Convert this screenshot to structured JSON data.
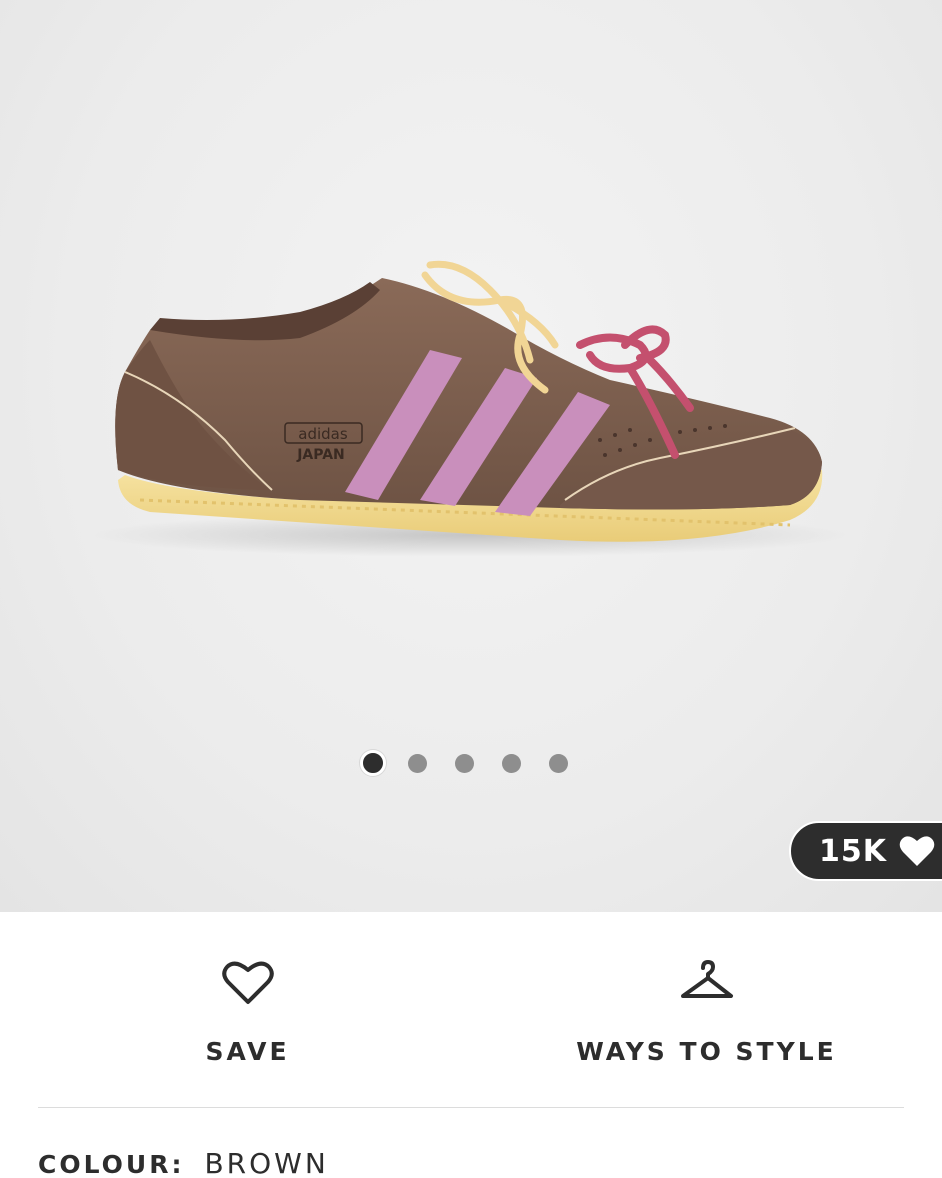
{
  "gallery": {
    "image_alt": "adidas JAPAN brown suede sneaker",
    "shoe_logo_text": "adidas",
    "shoe_logo_subtext": "JAPAN",
    "slide_count": 5,
    "active_slide": 1,
    "colors": {
      "suede": "#7d5f4e",
      "suede_dark": "#6b4f41",
      "stripes": "#c98fbc",
      "sole": "#f3dd94",
      "laces_main": "#f1d595",
      "laces_pink": "#c4506e"
    }
  },
  "likes": {
    "count": "15K",
    "icon": "heart-icon"
  },
  "actions": {
    "save_label": "SAVE",
    "save_icon": "heart-outline-icon",
    "style_label": "WAYS TO STYLE",
    "style_icon": "hanger-icon"
  },
  "colour": {
    "label": "COLOUR:",
    "value": "BROWN"
  },
  "theme": {
    "text": "#2d2d2d",
    "pill_bg": "#2d2d2d",
    "dot_inactive": "#8e8e8e"
  }
}
